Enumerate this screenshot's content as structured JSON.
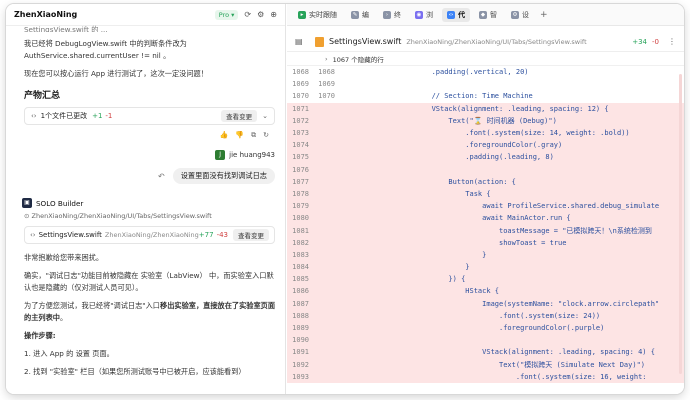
{
  "left": {
    "title": "ZhenXiaoNing",
    "pro_badge": "Pro ▾",
    "top_fragment_line": "SettingsView.swift 的 ...",
    "para1": "我已经将 DebugLogView.swift 中的判断条件改为 AuthService.shared.currentUser != nil 。",
    "para2": "现在您可以按心运行 App 进行测试了，这次一定没问题！",
    "section_title": "产物汇总",
    "file_change": {
      "label": "1个文件已更改",
      "added": "+1",
      "removed": "-1",
      "button": "查看变更"
    },
    "user_name": "jie huang943",
    "user_avatar": "J",
    "user_question": "设置里面没有找到调试日志",
    "bot_name": "SOLO Builder",
    "bot_path": "ZhenXiaoNing/ZhenXiaoNing/UI/Tabs/SettingsView.swift",
    "file_card": {
      "name": "SettingsView.swift",
      "path": "ZhenXiaoNing/ZhenXiaoNing/UI/Tabs/SettingsVie...",
      "added": "+77",
      "removed": "-43",
      "button": "查看变更"
    },
    "reply1": "非常抱歉给您带来困扰。",
    "reply2": "确实，\"调试日志\"功能目前被隐藏在 实验室（LabView） 中，而实验室入口默认也是隐藏的（仅对测试人员可见）。",
    "reply3_a": "为了方便您测试，我已经将\"调试日志\"入口",
    "reply3_b": "移出实验室，直接放在了实验室页面的主列表中",
    "reply3_c": "。",
    "steps_title": "操作步骤:",
    "step1": "1. 进入 App 的 设置 页面。",
    "step2": "2. 找到 \"实验室\" 栏目（如果您所测试账号中已被开启，应该能看到）"
  },
  "right": {
    "tabs": [
      {
        "label": "实时跟随",
        "icon": "follow-icon"
      },
      {
        "label": "编",
        "icon": "edit-icon"
      },
      {
        "label": "终",
        "icon": "terminal-icon"
      },
      {
        "label": "浏",
        "icon": "browser-icon"
      },
      {
        "label": "代",
        "icon": "code-icon"
      },
      {
        "label": "智",
        "icon": "agent-icon"
      },
      {
        "label": "设",
        "icon": "settings-icon"
      }
    ],
    "file": {
      "name": "SettingsView.swift",
      "path": "ZhenXiaoNing/ZhenXiaoNing/UI/Tabs/SettingsView.swift",
      "added": "+34",
      "removed": "-0"
    },
    "hidden_lines": "1067 个隐藏的行",
    "lines": [
      {
        "n1": "1068",
        "n2": "1068",
        "type": "ctx",
        "code": "            .padding(.vertical, 20)"
      },
      {
        "n1": "1069",
        "n2": "1069",
        "type": "ctx",
        "code": ""
      },
      {
        "n1": "1070",
        "n2": "1070",
        "type": "ctx",
        "code": "            // Section: Time Machine"
      },
      {
        "n1": "1071",
        "n2": "",
        "type": "add",
        "code": "            VStack(alignment: .leading, spacing: 12) {"
      },
      {
        "n1": "1072",
        "n2": "",
        "type": "add",
        "code": "                Text(\"⌛ 时间机器 (Debug)\")"
      },
      {
        "n1": "1073",
        "n2": "",
        "type": "add",
        "code": "                    .font(.system(size: 14, weight: .bold))"
      },
      {
        "n1": "1074",
        "n2": "",
        "type": "add",
        "code": "                    .foregroundColor(.gray)"
      },
      {
        "n1": "1075",
        "n2": "",
        "type": "add",
        "code": "                    .padding(.leading, 8)"
      },
      {
        "n1": "1076",
        "n2": "",
        "type": "add",
        "code": ""
      },
      {
        "n1": "1077",
        "n2": "",
        "type": "add",
        "code": "                Button(action: {"
      },
      {
        "n1": "1078",
        "n2": "",
        "type": "add",
        "code": "                    Task {"
      },
      {
        "n1": "1079",
        "n2": "",
        "type": "add",
        "code": "                        await ProfileService.shared.debug_simulate"
      },
      {
        "n1": "1080",
        "n2": "",
        "type": "add",
        "code": "                        await MainActor.run {"
      },
      {
        "n1": "1081",
        "n2": "",
        "type": "add",
        "code": "                            toastMessage = \"已模拟跨天！\\n系统检测到"
      },
      {
        "n1": "1082",
        "n2": "",
        "type": "add",
        "code": "                            showToast = true"
      },
      {
        "n1": "1083",
        "n2": "",
        "type": "add",
        "code": "                        }"
      },
      {
        "n1": "1084",
        "n2": "",
        "type": "add",
        "code": "                    }"
      },
      {
        "n1": "1085",
        "n2": "",
        "type": "add",
        "code": "                }) {"
      },
      {
        "n1": "1086",
        "n2": "",
        "type": "add",
        "code": "                    HStack {"
      },
      {
        "n1": "1087",
        "n2": "",
        "type": "add",
        "code": "                        Image(systemName: \"clock.arrow.circlepath\""
      },
      {
        "n1": "1088",
        "n2": "",
        "type": "add",
        "code": "                            .font(.system(size: 24))"
      },
      {
        "n1": "1089",
        "n2": "",
        "type": "add",
        "code": "                            .foregroundColor(.purple)"
      },
      {
        "n1": "1090",
        "n2": "",
        "type": "add",
        "code": ""
      },
      {
        "n1": "1091",
        "n2": "",
        "type": "add",
        "code": "                        VStack(alignment: .leading, spacing: 4) {"
      },
      {
        "n1": "1092",
        "n2": "",
        "type": "add",
        "code": "                            Text(\"模拟跨天 (Simulate Next Day)\")"
      },
      {
        "n1": "1093",
        "n2": "",
        "type": "add",
        "code": "                                .font(.system(size: 16, weight:"
      }
    ]
  }
}
